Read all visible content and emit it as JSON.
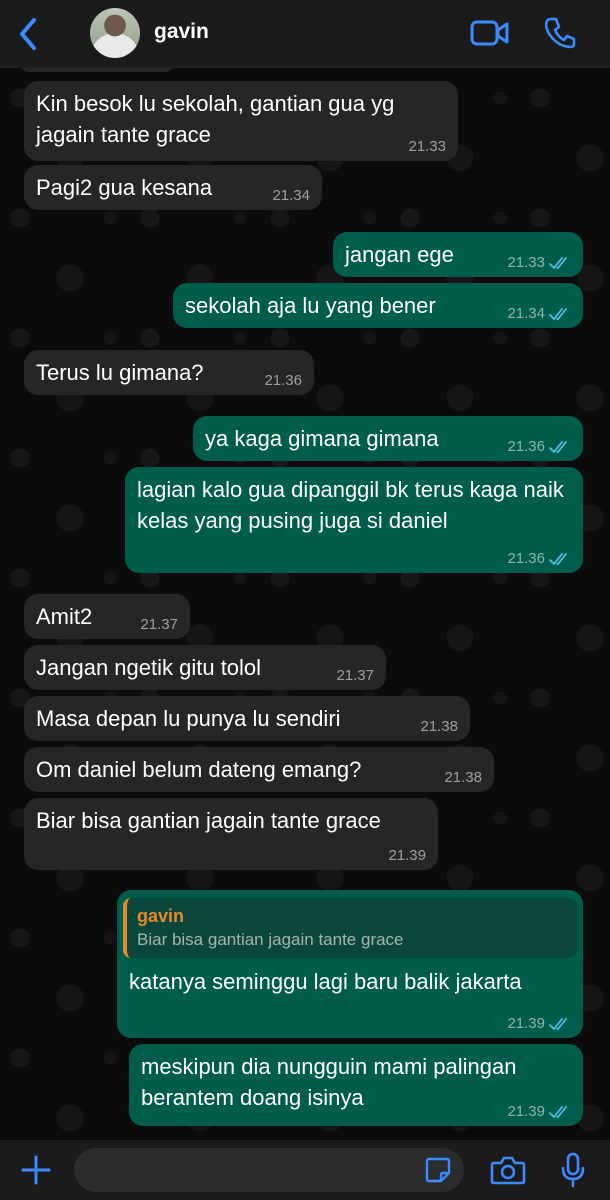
{
  "header": {
    "contact_name": "gavin",
    "icons": [
      "chevron-left-icon",
      "video-camera-icon",
      "phone-icon"
    ],
    "accent_color": "#3b8bff"
  },
  "messages": [
    {
      "dir": "in",
      "text": "Kin besok lu sekolah, gantian gua yg jagain tante grace",
      "time": "21.33"
    },
    {
      "dir": "in",
      "text": "Pagi2 gua kesana",
      "time": "21.34"
    },
    {
      "dir": "out",
      "text": "jangan ege",
      "time": "21.33",
      "read": true
    },
    {
      "dir": "out",
      "text": "sekolah aja lu yang bener",
      "time": "21.34",
      "read": true
    },
    {
      "dir": "in",
      "text": "Terus lu gimana?",
      "time": "21.36"
    },
    {
      "dir": "out",
      "text": "ya kaga gimana gimana",
      "time": "21.36",
      "read": true
    },
    {
      "dir": "out",
      "text": "lagian kalo gua dipanggil bk terus kaga naik kelas yang pusing juga si daniel",
      "time": "21.36",
      "read": true
    },
    {
      "dir": "in",
      "text": "Amit2",
      "time": "21.37"
    },
    {
      "dir": "in",
      "text": "Jangan ngetik gitu tolol",
      "time": "21.37"
    },
    {
      "dir": "in",
      "text": "Masa depan lu punya lu sendiri",
      "time": "21.38"
    },
    {
      "dir": "in",
      "text": "Om daniel belum dateng emang?",
      "time": "21.38"
    },
    {
      "dir": "in",
      "text": "Biar bisa gantian jagain tante grace",
      "time": "21.39"
    },
    {
      "dir": "out",
      "reply_to": {
        "name": "gavin",
        "text": "Biar bisa gantian jagain tante grace"
      },
      "text": "katanya seminggu lagi baru balik jakarta",
      "time": "21.39",
      "read": true
    },
    {
      "dir": "out",
      "text": "meskipun dia nungguin mami palingan berantem doang isinya",
      "time": "21.39",
      "read": true
    }
  ],
  "colors": {
    "incoming_bubble": "#262626",
    "outgoing_bubble": "#005c4b",
    "reply_name": "#e8882b",
    "read_ticks": "#53bdeb"
  },
  "composer": {
    "placeholder": "",
    "icons": [
      "plus-icon",
      "sticker-icon",
      "camera-icon",
      "microphone-icon"
    ]
  }
}
